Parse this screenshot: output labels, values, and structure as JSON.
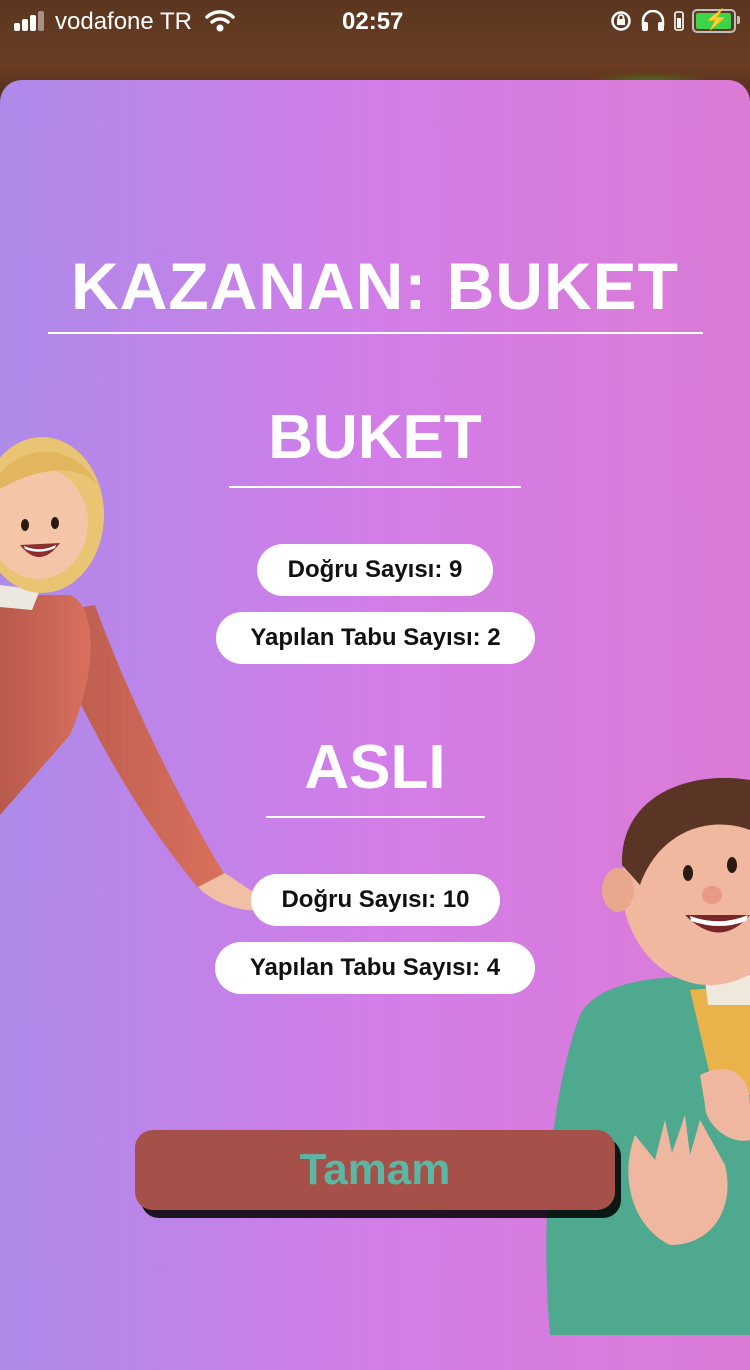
{
  "status_bar": {
    "carrier": "vodafone TR",
    "time": "02:57",
    "battery_level": "charging"
  },
  "result": {
    "winner_title": "KAZANAN: BUKET",
    "players": [
      {
        "name": "BUKET",
        "correct": "Doğru Sayısı: 9",
        "taboo": "Yapılan Tabu Sayısı: 2"
      },
      {
        "name": "ASLI",
        "correct": "Doğru Sayısı: 10",
        "taboo": "Yapılan Tabu Sayısı: 4"
      }
    ]
  },
  "actions": {
    "ok_label": "Tamam"
  },
  "colors": {
    "gradient_start": "#ad8ae9",
    "gradient_end": "#dc7bd6",
    "button_bg": "#a5514a",
    "button_text": "#5bb7a3"
  }
}
